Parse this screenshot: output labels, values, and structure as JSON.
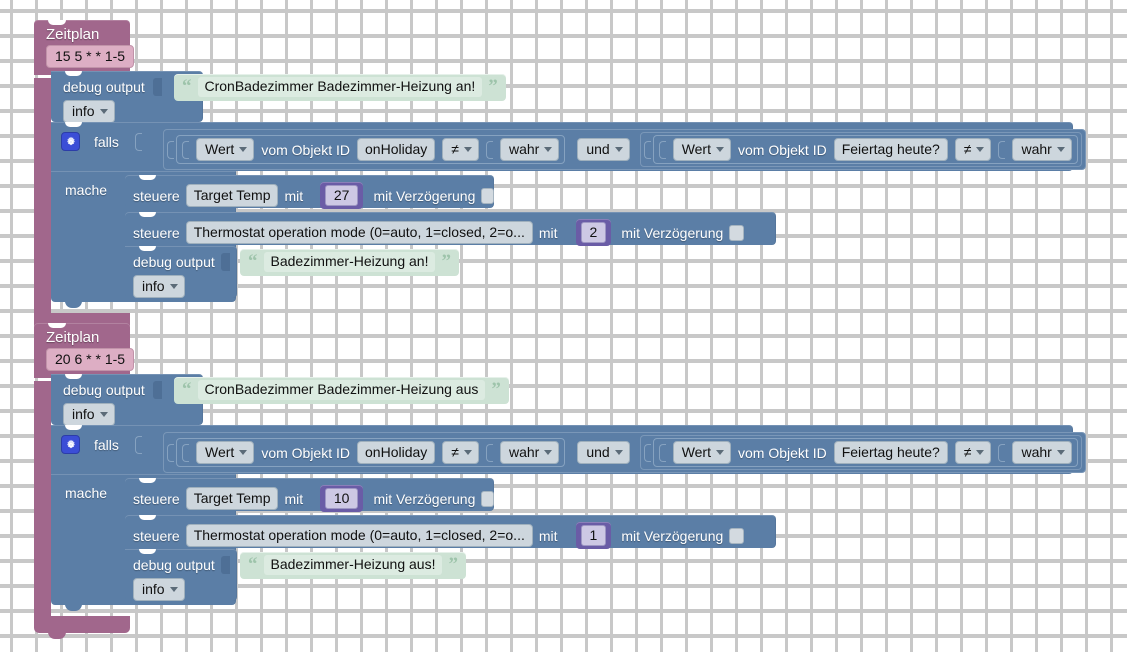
{
  "app": {
    "title": "Blockly Script Editor",
    "canvas_background": "#ffffff",
    "grid_dot_color": "#c8c8c8"
  },
  "colors": {
    "schedule_block": "#a1678c",
    "schedule_field": "#ddaec4",
    "statement_block": "#5b7ea6",
    "string_block": "#cde2d4",
    "number_block": "#6a5ca6",
    "field": "#cdd6dd",
    "mutator_icon": "#3b4ed6"
  },
  "labels": {
    "schedule": "Zeitplan",
    "debug_output": "debug output",
    "if": "falls",
    "do": "mache",
    "control": "steuere",
    "with": "mit",
    "with_delay": "mit Verzögerung",
    "value_of_object_id": "vom Objekt ID",
    "and": "und"
  },
  "icons": {
    "mutator": "gear-icon",
    "dropdown": "chevron-down-icon",
    "quote_open": "“",
    "quote_close": "”"
  },
  "blocks": [
    {
      "id": "schedule-1",
      "type": "schedule",
      "header": "Zeitplan",
      "cron": "15 5 * * 1-5",
      "debug": {
        "label": "debug output",
        "severity": "info",
        "text": "CronBadezimmer Badezimmer-Heizung an!"
      },
      "condition": {
        "if_label": "falls",
        "do_label": "mache",
        "operator": "und",
        "comparisons": [
          {
            "attribute": "Wert",
            "prefix": "vom Objekt ID",
            "object_id": "onHoliday",
            "operator": "≠",
            "value": "wahr"
          },
          {
            "attribute": "Wert",
            "prefix": "vom Objekt ID",
            "object_id": "Feiertag heute?",
            "operator": "≠",
            "value": "wahr"
          }
        ]
      },
      "actions": [
        {
          "verb": "steuere",
          "target": "Target Temp",
          "with_label": "mit",
          "value": "27",
          "delay_label": "mit Verzögerung",
          "delay_checked": false
        },
        {
          "verb": "steuere",
          "target": "Thermostat operation mode (0=auto, 1=closed, 2=o...",
          "with_label": "mit",
          "value": "2",
          "delay_label": "mit Verzögerung",
          "delay_checked": false
        }
      ],
      "inner_debug": {
        "label": "debug output",
        "severity": "info",
        "text": "Badezimmer-Heizung an!"
      }
    },
    {
      "id": "schedule-2",
      "type": "schedule",
      "header": "Zeitplan",
      "cron": "20 6 * * 1-5",
      "debug": {
        "label": "debug output",
        "severity": "info",
        "text": "CronBadezimmer Badezimmer-Heizung aus"
      },
      "condition": {
        "if_label": "falls",
        "do_label": "mache",
        "operator": "und",
        "comparisons": [
          {
            "attribute": "Wert",
            "prefix": "vom Objekt ID",
            "object_id": "onHoliday",
            "operator": "≠",
            "value": "wahr"
          },
          {
            "attribute": "Wert",
            "prefix": "vom Objekt ID",
            "object_id": "Feiertag heute?",
            "operator": "≠",
            "value": "wahr"
          }
        ]
      },
      "actions": [
        {
          "verb": "steuere",
          "target": "Target Temp",
          "with_label": "mit",
          "value": "10",
          "delay_label": "mit Verzögerung",
          "delay_checked": false
        },
        {
          "verb": "steuere",
          "target": "Thermostat operation mode (0=auto, 1=closed, 2=o...",
          "with_label": "mit",
          "value": "1",
          "delay_label": "mit Verzögerung",
          "delay_checked": false
        }
      ],
      "inner_debug": {
        "label": "debug output",
        "severity": "info",
        "text": "Badezimmer-Heizung aus!"
      }
    }
  ]
}
